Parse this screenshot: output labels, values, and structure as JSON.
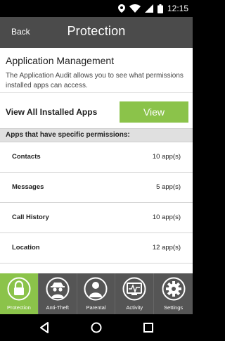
{
  "status": {
    "time": "12:15"
  },
  "header": {
    "back_label": "Back",
    "title": "Protection"
  },
  "app_management": {
    "title": "Application Management",
    "description": "The Application Audit allows you to see what permissions installed apps can access.",
    "view_all_label": "View All Installed Apps",
    "view_button": "View"
  },
  "permissions": {
    "heading": "Apps that have specific permissions:",
    "rows": [
      {
        "label": "Contacts",
        "value": "10 app(s)"
      },
      {
        "label": "Messages",
        "value": "5 app(s)"
      },
      {
        "label": "Call History",
        "value": "10 app(s)"
      },
      {
        "label": "Location",
        "value": "12 app(s)"
      }
    ]
  },
  "tabs": [
    {
      "label": "Protection",
      "icon": "lock-icon",
      "active": true
    },
    {
      "label": "Anti-Theft",
      "icon": "spy-icon",
      "active": false
    },
    {
      "label": "Parental",
      "icon": "person-icon",
      "active": false
    },
    {
      "label": "Activity",
      "icon": "monitor-icon",
      "active": false
    },
    {
      "label": "Settings",
      "icon": "gear-icon",
      "active": false
    }
  ],
  "colors": {
    "accent": "#8bc34a",
    "appbar": "#4b4b4b",
    "tabbar": "#555555"
  }
}
